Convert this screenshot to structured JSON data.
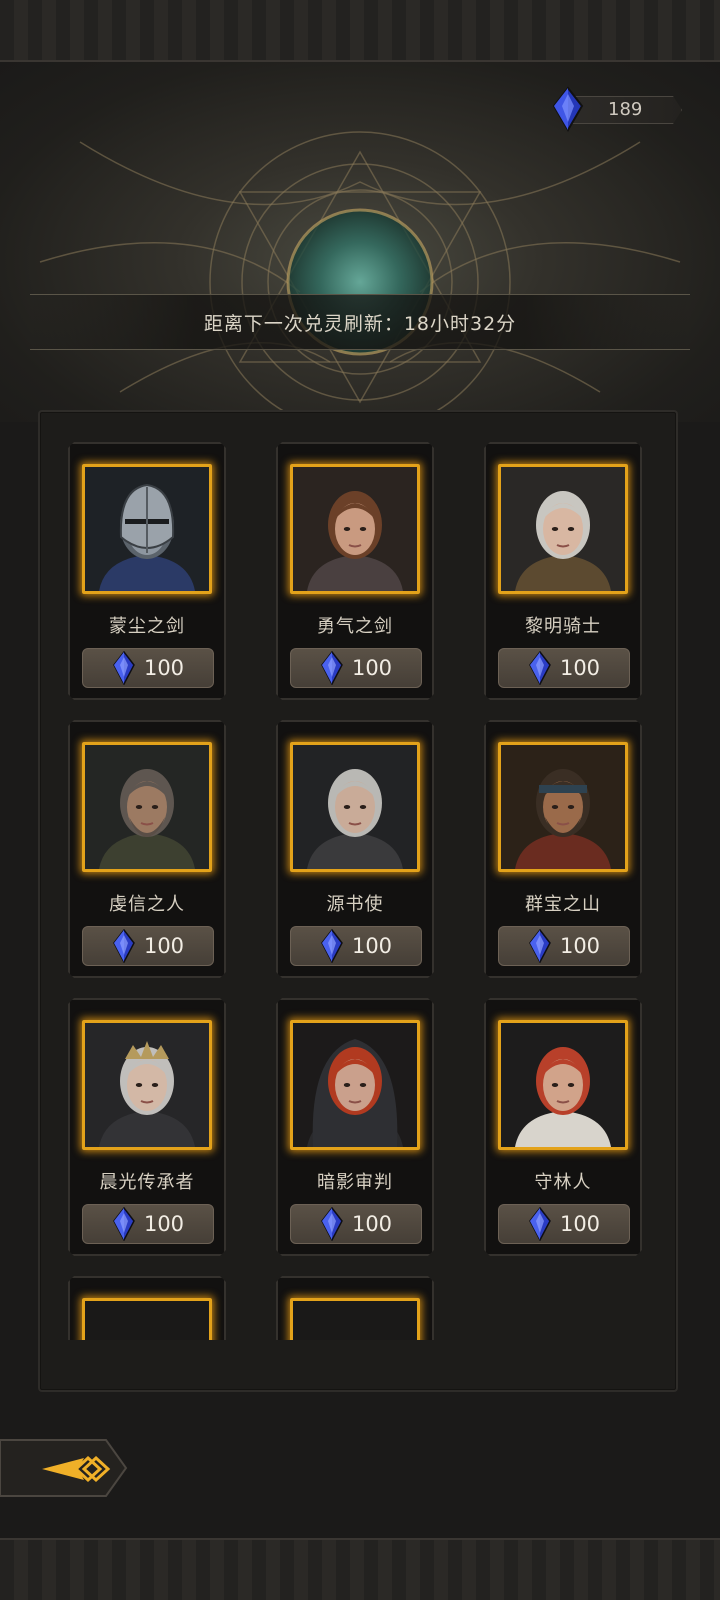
{
  "currency": {
    "icon": "crystal-icon",
    "value": "189"
  },
  "refresh": {
    "text": "距离下一次兑灵刷新：18小时32分"
  },
  "heroes": [
    {
      "name": "蒙尘之剑",
      "price": "100",
      "portrait": "armored-knight"
    },
    {
      "name": "勇气之剑",
      "price": "100",
      "portrait": "brown-hair-woman"
    },
    {
      "name": "黎明骑士",
      "price": "100",
      "portrait": "silver-hair-woman"
    },
    {
      "name": "虔信之人",
      "price": "100",
      "portrait": "bearded-man"
    },
    {
      "name": "源书使",
      "price": "100",
      "portrait": "silver-hair-youth"
    },
    {
      "name": "群宝之山",
      "price": "100",
      "portrait": "bandana-dwarf"
    },
    {
      "name": "晨光传承者",
      "price": "100",
      "portrait": "crowned-white-hair"
    },
    {
      "name": "暗影审判",
      "price": "100",
      "portrait": "hooded-red-hair"
    },
    {
      "name": "守林人",
      "price": "100",
      "portrait": "red-hair-ranger"
    },
    {
      "name": "",
      "price": "",
      "portrait": "partial"
    },
    {
      "name": "",
      "price": "",
      "portrait": "partial"
    }
  ],
  "colors": {
    "frame_gold": "#e3a21a",
    "gem_blue": "#3c4fd8",
    "price_button": "#5a5146"
  },
  "navigation": {
    "back_icon": "back-arrow-icon"
  }
}
